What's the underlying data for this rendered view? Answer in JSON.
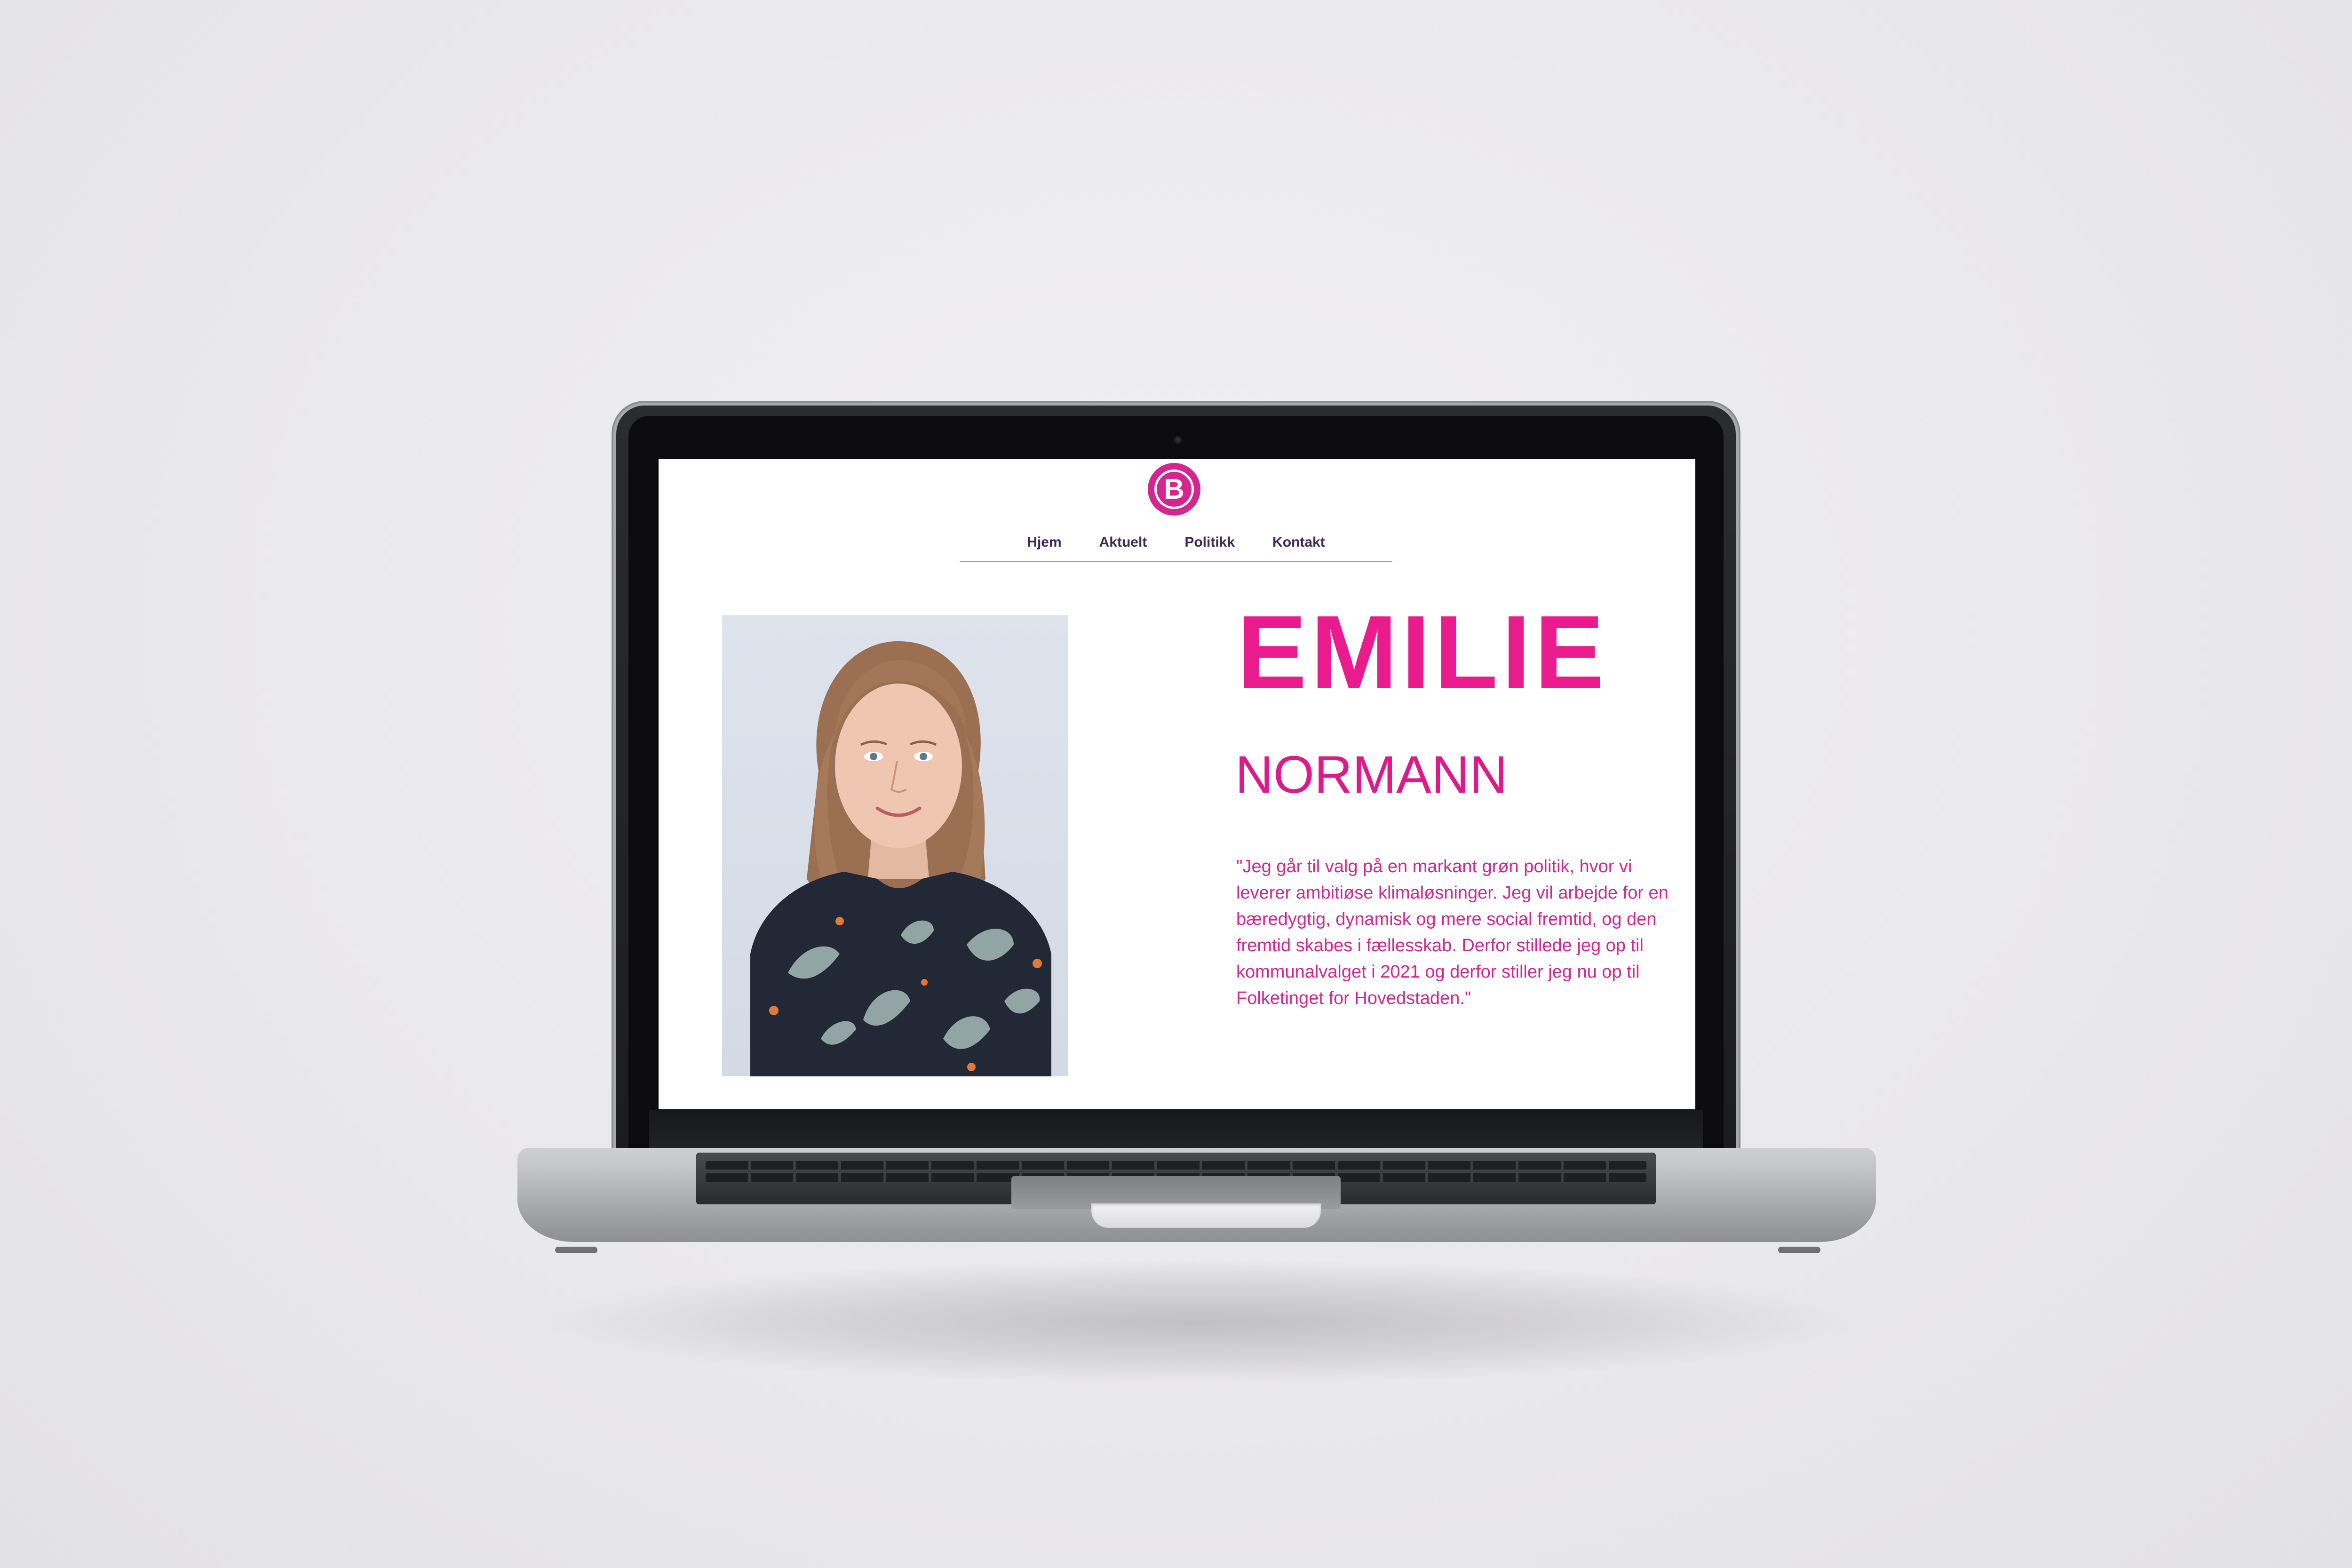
{
  "site": {
    "logo_letter": "B",
    "nav": {
      "items": [
        {
          "label": "Hjem"
        },
        {
          "label": "Aktuelt"
        },
        {
          "label": "Politikk"
        },
        {
          "label": "Kontakt"
        }
      ]
    },
    "hero": {
      "first_name": "EMILIE",
      "last_name": "NORMANN",
      "quote": "\"Jeg går til valg på en markant grøn politik, hvor vi leverer ambitiøse klimaløsninger. Jeg vil arbejde for en bæredygtig, dynamisk og mere social fremtid, og den fremtid skabes i fællesskab. Derfor stillede jeg op til kommunalvalget i 2021 og derfor stiller jeg nu op til Folketinget for Hovedstaden.\""
    }
  },
  "colors": {
    "brand_pink": "#ea1b8c",
    "logo_pink": "#d42591",
    "nav_text": "#3b2a5a",
    "nav_rule": "#9a9aa8"
  },
  "icons": {
    "logo": "party-logo-b-icon"
  }
}
